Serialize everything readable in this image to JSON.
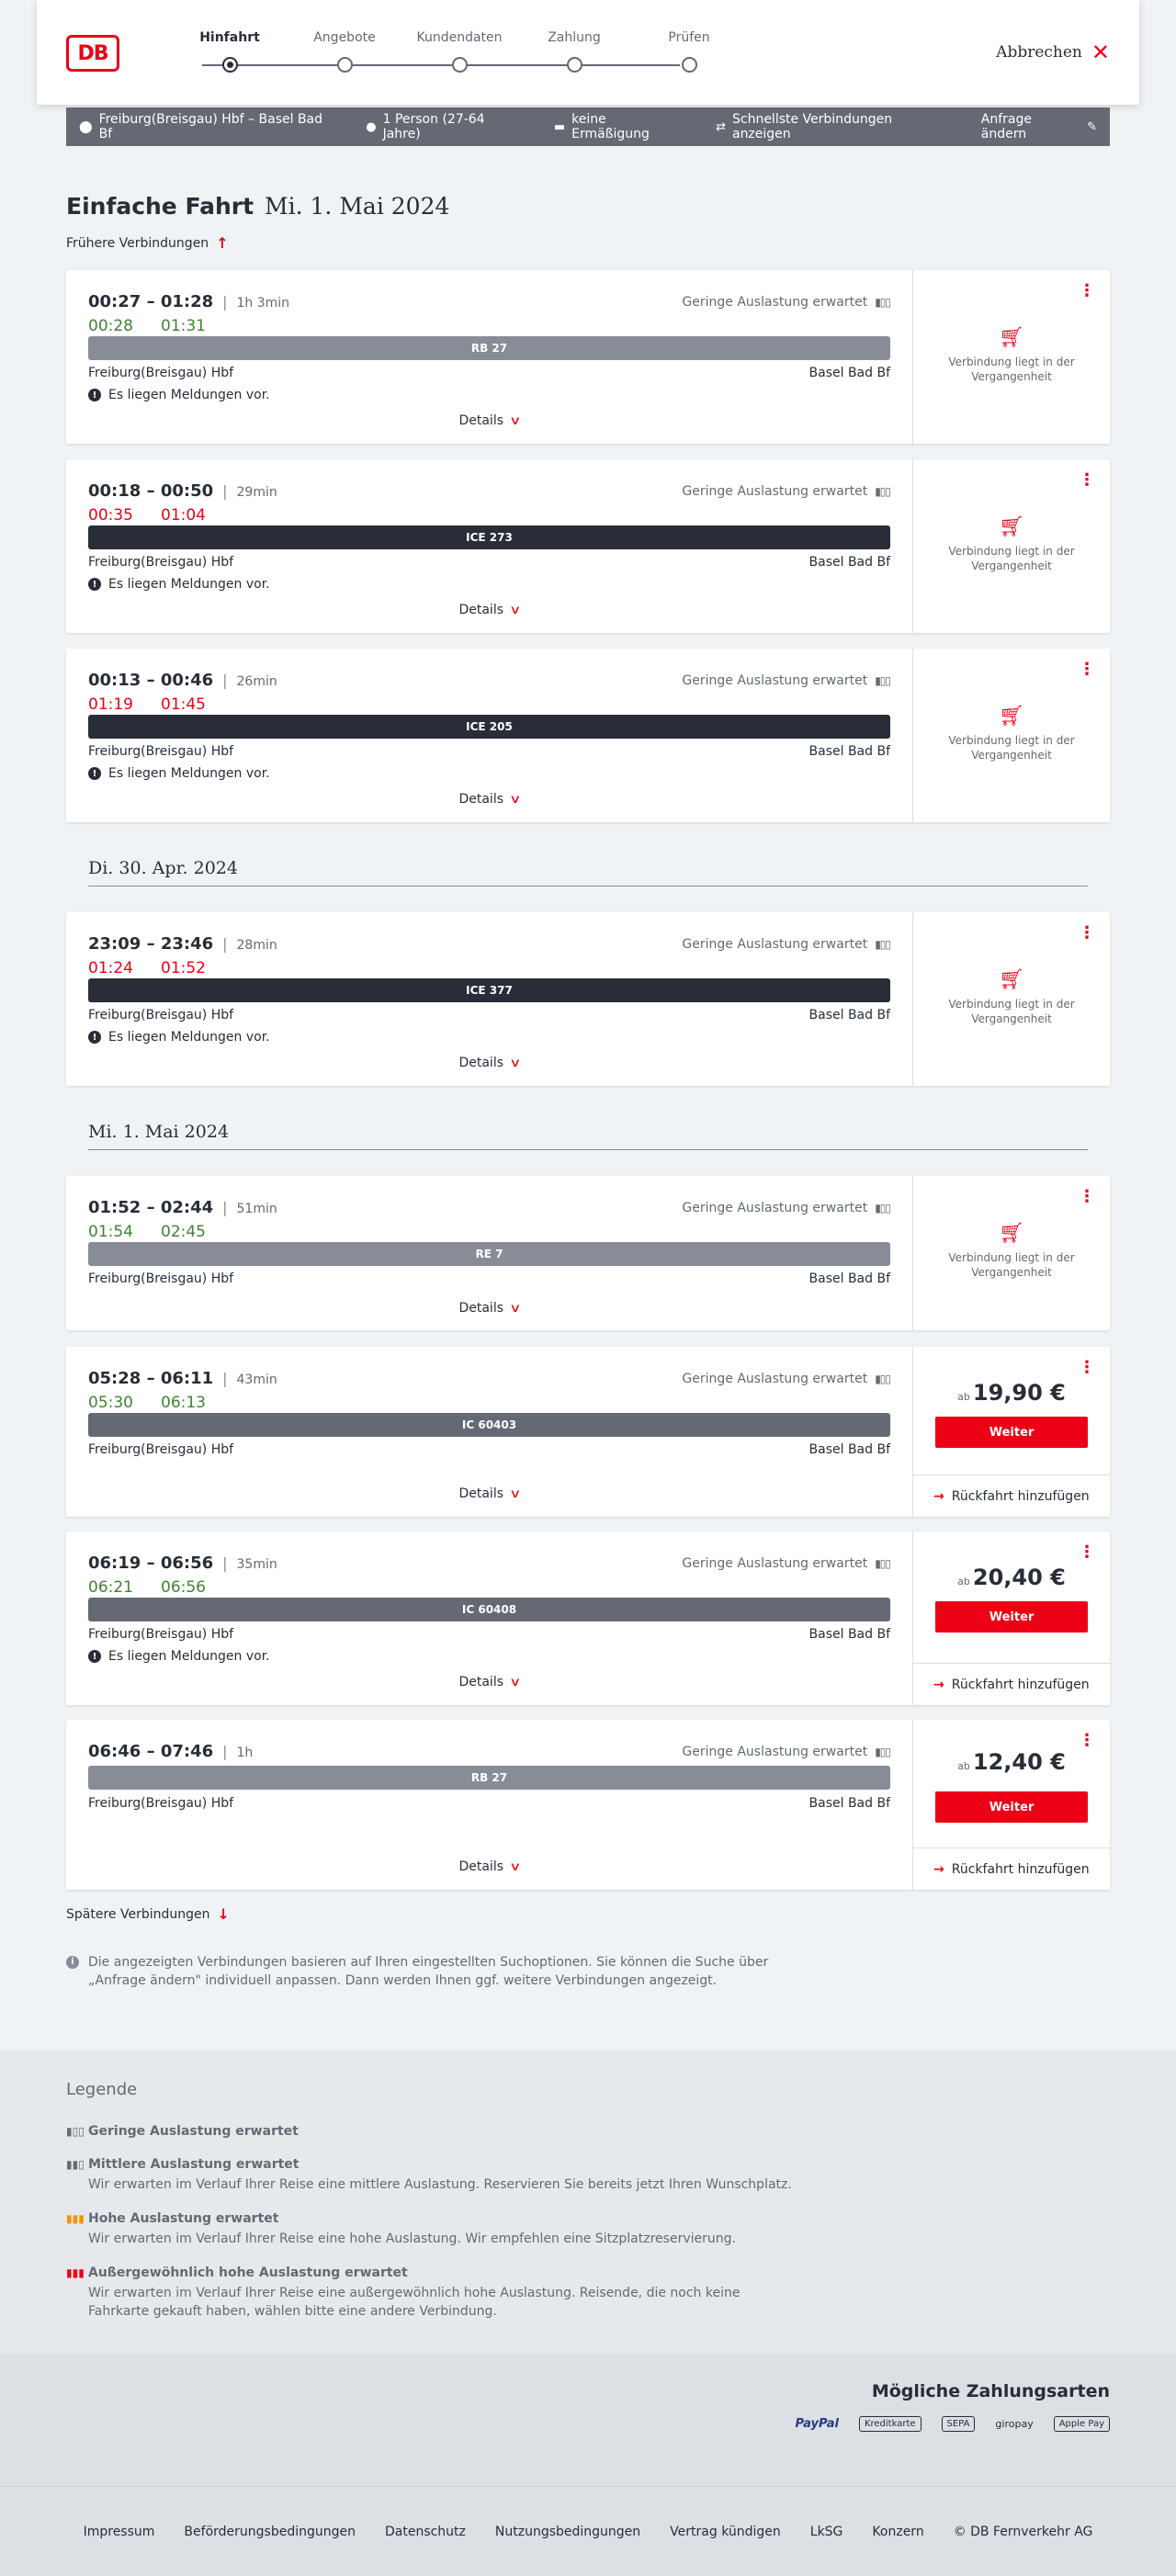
{
  "header": {
    "logo": "DB",
    "steps": [
      {
        "label": "Hinfahrt",
        "active": true
      },
      {
        "label": "Angebote",
        "active": false
      },
      {
        "label": "Kundendaten",
        "active": false
      },
      {
        "label": "Zahlung",
        "active": false
      },
      {
        "label": "Prüfen",
        "active": false
      }
    ],
    "cancel": "Abbrechen"
  },
  "search": {
    "route": "Freiburg(Breisgau) Hbf – Basel Bad Bf",
    "persons": "1 Person (27-64 Jahre)",
    "discount": "keine Ermäßigung",
    "fastest": "Schnellste Verbindungen anzeigen",
    "change": "Anfrage ändern"
  },
  "main": {
    "title_strong": "Einfache Fahrt",
    "title_date": "Mi. 1. Mai 2024",
    "earlier": "Frühere Verbindungen",
    "later": "Spätere Verbindungen",
    "info": "Die angezeigten Verbindungen basieren auf Ihren eingestellten Suchoptionen. Sie können die Suche über „Anfrage ändern\" individuell anpassen. Dann werden Ihnen ggf. weitere Verbindungen angezeigt."
  },
  "common": {
    "load": "Geringe Auslastung erwartet",
    "details": "Details",
    "message": "Es liegen Meldungen vor.",
    "past_line1": "Verbindung liegt in der",
    "past_line2": "Vergangenheit",
    "from_prefix": "ab",
    "weiter": "Weiter",
    "return": "Rückfahrt hinzufügen",
    "from": "Freiburg(Breisgau) Hbf",
    "to": "Basel Bad Bf"
  },
  "days": [
    "Di. 30. Apr. 2024",
    "Mi. 1. Mai 2024"
  ],
  "connections": [
    {
      "time": "00:27 – 01:28",
      "duration": "1h 3min",
      "rt_dep": "00:28",
      "rt_arr": "01:31",
      "rt_status": "green",
      "train": "RB 27",
      "style": "light",
      "message": true,
      "price": null
    },
    {
      "time": "00:18 – 00:50",
      "duration": "29min",
      "rt_dep": "00:35",
      "rt_arr": "01:04",
      "rt_status": "red",
      "train": "ICE 273",
      "style": "dark",
      "message": true,
      "price": null
    },
    {
      "time": "00:13 – 00:46",
      "duration": "26min",
      "rt_dep": "01:19",
      "rt_arr": "01:45",
      "rt_status": "red",
      "train": "ICE 205",
      "style": "dark",
      "message": true,
      "price": null
    },
    {
      "time": "23:09 – 23:46",
      "duration": "28min",
      "rt_dep": "01:24",
      "rt_arr": "01:52",
      "rt_status": "red",
      "train": "ICE 377",
      "style": "dark",
      "message": true,
      "price": null
    },
    {
      "time": "01:52 – 02:44",
      "duration": "51min",
      "rt_dep": "01:54",
      "rt_arr": "02:45",
      "rt_status": "green",
      "train": "RE 7",
      "style": "light",
      "message": false,
      "price": null
    },
    {
      "time": "05:28 – 06:11",
      "duration": "43min",
      "rt_dep": "05:30",
      "rt_arr": "06:13",
      "rt_status": "green",
      "train": "IC 60403",
      "style": "mid",
      "message": false,
      "price": "19,90 €"
    },
    {
      "time": "06:19 – 06:56",
      "duration": "35min",
      "rt_dep": "06:21",
      "rt_arr": "06:56",
      "rt_status": "green",
      "train": "IC 60408",
      "style": "mid",
      "message": true,
      "price": "20,40 €"
    },
    {
      "time": "06:46 – 07:46",
      "duration": "1h",
      "rt_dep": "",
      "rt_arr": "",
      "rt_status": "none",
      "train": "RB 27",
      "style": "light",
      "message": false,
      "price": "12,40 €"
    }
  ],
  "legend": {
    "title": "Legende",
    "items": [
      {
        "title": "Geringe Auslastung erwartet",
        "desc": ""
      },
      {
        "title": "Mittlere Auslastung erwartet",
        "desc": "Wir erwarten im Verlauf Ihrer Reise eine mittlere Auslastung. Reservieren Sie bereits jetzt Ihren Wunschplatz."
      },
      {
        "title": "Hohe Auslastung erwartet",
        "desc": "Wir erwarten im Verlauf Ihrer Reise eine hohe Auslastung. Wir empfehlen eine Sitzplatzreservierung."
      },
      {
        "title": "Außergewöhnlich hohe Auslastung erwartet",
        "desc": "Wir erwarten im Verlauf Ihrer Reise eine außergewöhnlich hohe Auslastung. Reisende, die noch keine Fahrkarte gekauft haben, wählen bitte eine andere Verbindung."
      }
    ]
  },
  "payment": {
    "title": "Mögliche Zahlungsarten",
    "methods": [
      "PayPal",
      "Kreditkarte",
      "SEPA",
      "giropay",
      "Apple Pay"
    ]
  },
  "footer": {
    "links": [
      "Impressum",
      "Beförderungsbedingungen",
      "Datenschutz",
      "Nutzungsbedingungen",
      "Vertrag kündigen",
      "LkSG",
      "Konzern",
      "© DB Fernverkehr AG"
    ]
  },
  "colors": {
    "accent": "#ec0016",
    "dark": "#282d37",
    "green": "#408335",
    "grey": "#646973"
  }
}
